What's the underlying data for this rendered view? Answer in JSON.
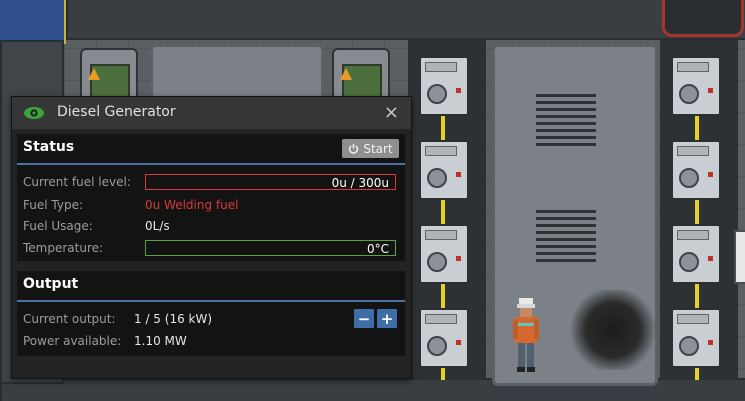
{
  "window": {
    "title": "Diesel Generator",
    "close_glyph": "×",
    "title_icon": "eye-icon"
  },
  "status": {
    "heading": "Status",
    "start_label": "Start",
    "start_icon": "power-icon",
    "fuel_level_label": "Current fuel level:",
    "fuel_level_value": "0u / 300u",
    "fuel_level_fraction": 0,
    "fuel_type_label": "Fuel Type:",
    "fuel_type_value": "0u Welding fuel",
    "fuel_usage_label": "Fuel Usage:",
    "fuel_usage_value": "0L/s",
    "temperature_label": "Temperature:",
    "temperature_value": "0°C",
    "temperature_fraction": 0
  },
  "output": {
    "heading": "Output",
    "current_output_label": "Current output:",
    "current_output_value": "1 / 5 (16 kW)",
    "decrease_label": "−",
    "increase_label": "+",
    "power_available_label": "Power available:",
    "power_available_value": "1.10 MW"
  },
  "colors": {
    "accent": "#4972a1",
    "fuel_bar_border": "#d03c3c",
    "fuel_type_text": "#d03c3c",
    "temperature_bar_border": "#5ca346",
    "eye_icon": "#3da33d"
  }
}
